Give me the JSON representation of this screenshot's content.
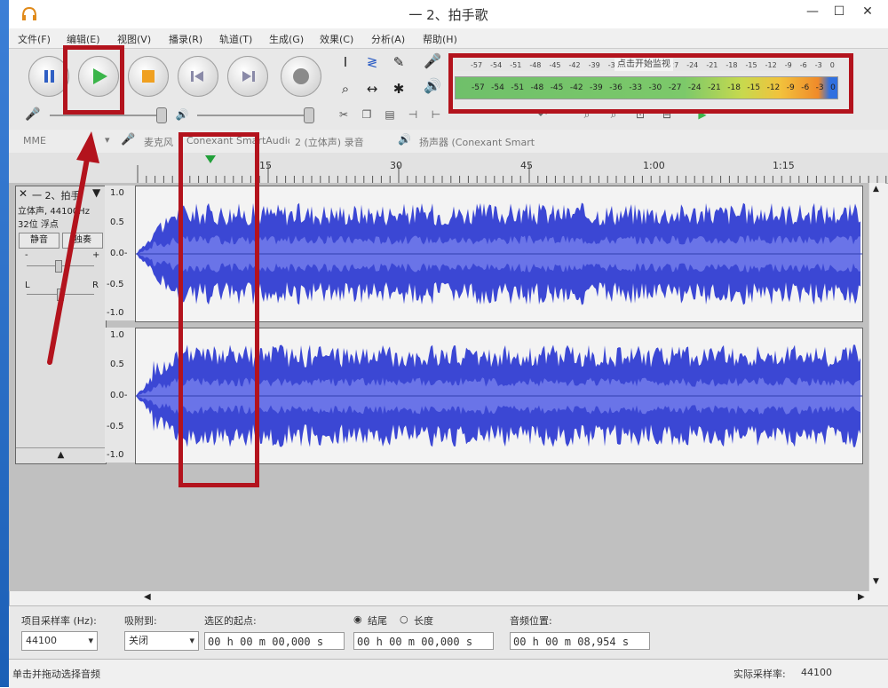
{
  "window": {
    "title": "一 2、拍手歌",
    "minimize": "—",
    "maximize": "☐",
    "close": "✕"
  },
  "menu": [
    "文件(F)",
    "编辑(E)",
    "视图(V)",
    "播录(R)",
    "轨道(T)",
    "生成(G)",
    "效果(C)",
    "分析(A)",
    "帮助(H)"
  ],
  "toolbar": {
    "pause_icon": "pause-icon",
    "play_icon": "play-icon",
    "stop_icon": "stop-icon",
    "skip_start_icon": "skip-start-icon",
    "skip_end_icon": "skip-end-icon",
    "record_icon": "record-icon",
    "tools": [
      "I",
      "≷",
      "✎",
      "⌕",
      "↔",
      "✱"
    ],
    "meter_tooltip": "点击开始监视",
    "meter_ticks": [
      "-57",
      "-54",
      "-51",
      "-48",
      "-45",
      "-42",
      "-39",
      "-36",
      "-33",
      "-30",
      "-27",
      "-24",
      "-21",
      "-18",
      "-15",
      "-12",
      "-9",
      "-6",
      "-3",
      "0"
    ]
  },
  "devices": {
    "host": "MME",
    "mic_label": "麦克风",
    "input_device": "Conexant SmartAudio",
    "channels": "2 (立体声) 录音",
    "output_device": "扬声器 (Conexant Smart"
  },
  "ruler": {
    "labels": [
      "15",
      "30",
      "45",
      "1:00",
      "1:15"
    ]
  },
  "track": {
    "name": "一 2、拍手",
    "info1": "立体声, 44100Hz",
    "info2": "32位 浮点",
    "mute": "静音",
    "solo": "独奏",
    "gain_minus": "-",
    "gain_plus": "+",
    "pan_left": "L",
    "pan_right": "R",
    "scale": [
      "1.0",
      "0.5",
      "0.0-",
      "-0.5",
      "-1.0"
    ],
    "collapse": "▲"
  },
  "selection": {
    "rate_label": "项目采样率 (Hz):",
    "rate_value": "44100",
    "snap_label": "吸附到:",
    "snap_value": "关闭",
    "start_label": "选区的起点:",
    "end_label": "结尾",
    "length_label": "长度",
    "start_value": "00 h 00 m 00,000 s",
    "end_value": "00 h 00 m 00,000 s",
    "pos_label": "音频位置:",
    "pos_value": "00 h 00 m 08,954 s"
  },
  "status": {
    "left": "单击并拖动选择音频",
    "rate_label": "实际采样率:",
    "rate_value": "44100"
  },
  "colors": {
    "annotation": "#b3131d",
    "wave": "#3b47d4",
    "play": "#3bb54a"
  }
}
